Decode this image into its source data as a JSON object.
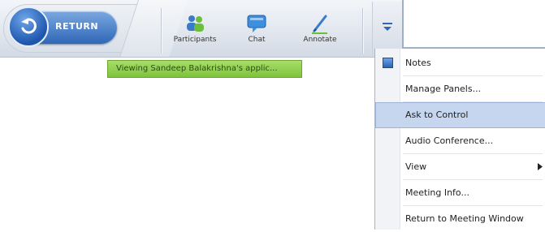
{
  "toolbar": {
    "return_label": "RETURN",
    "buttons": [
      {
        "label": "Participants",
        "icon": "participants-icon"
      },
      {
        "label": "Chat",
        "icon": "chat-icon"
      },
      {
        "label": "Annotate",
        "icon": "annotate-icon"
      }
    ],
    "dropdown_icon": "chevron-down-icon"
  },
  "status_banner": {
    "text": "Viewing Sandeep Balakrishna's applic..."
  },
  "menu": {
    "items": [
      {
        "label": "Notes",
        "checked": true
      },
      {
        "label": "Manage Panels..."
      },
      {
        "label": "Ask to Control",
        "highlighted": true
      },
      {
        "label": "Audio Conference..."
      },
      {
        "label": "View",
        "submenu": true
      },
      {
        "label": "Meeting Info..."
      },
      {
        "label": "Return to Meeting Window"
      }
    ]
  },
  "colors": {
    "accent_blue": "#2f67b7",
    "banner_green": "#8fcf4a",
    "menu_highlight": "#c6d6ee"
  }
}
